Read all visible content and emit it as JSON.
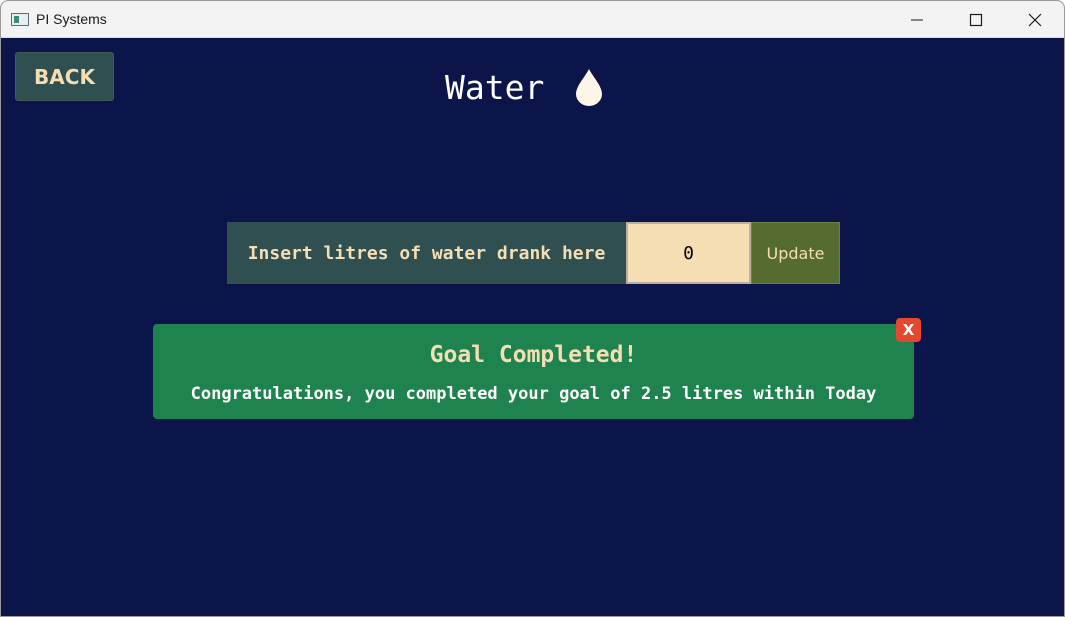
{
  "window": {
    "title": "PI Systems",
    "controls": {
      "minimize_icon": "minimize-icon",
      "maximize_icon": "maximize-icon",
      "close_icon": "close-icon"
    }
  },
  "header": {
    "back_label": "BACK",
    "title": "Water",
    "icon": "water-drop-icon"
  },
  "form": {
    "label": "Insert litres of water drank here",
    "input_value": "0",
    "update_label": "Update"
  },
  "alert": {
    "title": "Goal Completed!",
    "message": "Congratulations, you completed your goal of 2.5 litres within Today",
    "close_label": "X"
  },
  "colors": {
    "background": "#0c1549",
    "accent_text": "#f6deb4",
    "button_teal": "#2f4f50",
    "update_olive": "#556b2f",
    "input_bg": "#f5deb4",
    "alert_green": "#1f834f",
    "alert_close": "#e4492f"
  }
}
